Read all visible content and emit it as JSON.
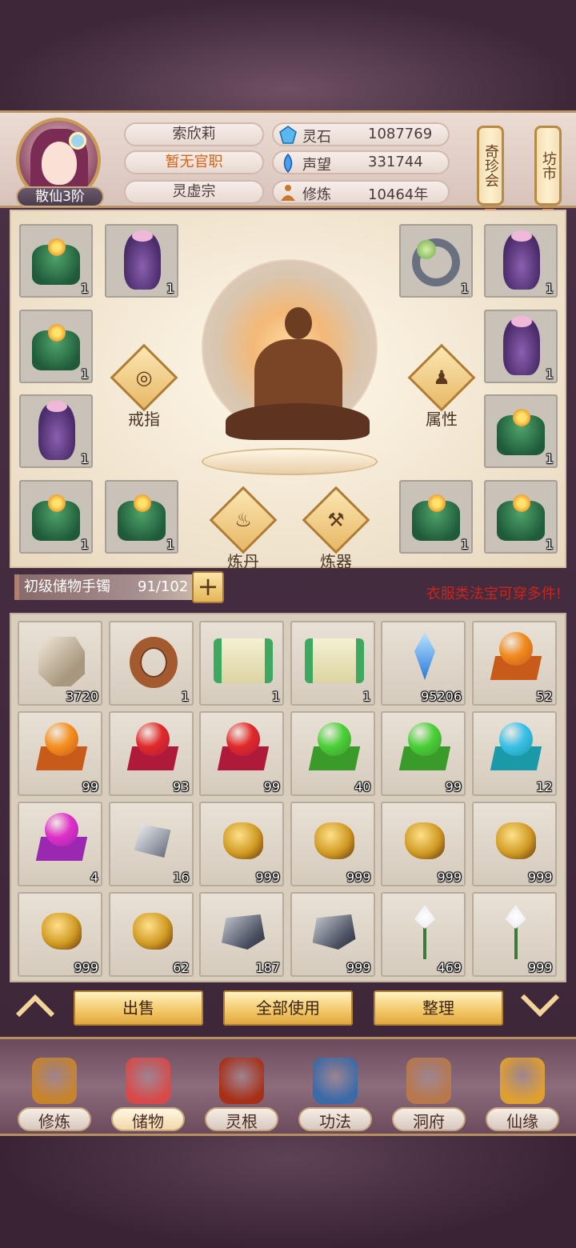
{
  "header": {
    "rank": "散仙3阶",
    "name": "索欣莉",
    "official": "暂无官职",
    "sect": "灵虚宗",
    "resources": [
      {
        "icon": "spirit-stone-icon",
        "label": "灵石",
        "value": "1087769"
      },
      {
        "icon": "reputation-icon",
        "label": "声望",
        "value": "331744"
      },
      {
        "icon": "cultivation-icon",
        "label": "修炼",
        "value": "10464年"
      }
    ],
    "treasure_hall": "奇珍会",
    "market": "坊市"
  },
  "equipment": {
    "slots": [
      {
        "icon": "green-robe-icon",
        "qty": "1"
      },
      {
        "icon": "purple-robe-icon",
        "qty": "1"
      },
      {
        "icon": "jade-ring-icon",
        "qty": "1"
      },
      {
        "icon": "purple-robe-icon",
        "qty": "1"
      },
      {
        "icon": "green-robe-icon",
        "qty": "1"
      },
      {
        "icon": "purple-robe-icon",
        "qty": "1"
      },
      {
        "icon": "purple-robe-icon",
        "qty": "1"
      },
      {
        "icon": "green-robe-icon",
        "qty": "1"
      },
      {
        "icon": "green-robe-icon",
        "qty": "1"
      },
      {
        "icon": "green-robe-icon",
        "qty": "1"
      },
      {
        "icon": "green-robe-icon",
        "qty": "1"
      },
      {
        "icon": "green-robe-icon",
        "qty": "1"
      }
    ],
    "ring_label": "戒指",
    "attr_label": "属性",
    "alchemy_label": "炼丹",
    "forge_label": "炼器"
  },
  "storage": {
    "name": "初级储物手镯",
    "capacity": "91/102",
    "plus": "+",
    "hint": "衣服类法宝可穿多件!"
  },
  "bag": [
    {
      "icon": "rune-stone-icon",
      "qty": "3720"
    },
    {
      "icon": "wooden-ring-icon",
      "qty": "1"
    },
    {
      "icon": "green-scroll-icon",
      "qty": "1"
    },
    {
      "icon": "green-scroll-icon",
      "qty": "1"
    },
    {
      "icon": "blue-crystal-icon",
      "qty": "95206"
    },
    {
      "icon": "orange-orb-icon",
      "qty": "52",
      "ball": "#f08a1c",
      "stand": "#c85a1a"
    },
    {
      "icon": "orange-orb-icon",
      "qty": "99",
      "ball": "#f4901e",
      "stand": "#c85a1a"
    },
    {
      "icon": "red-orb-icon",
      "qty": "93",
      "ball": "#e02a2a",
      "stand": "#b01a3a"
    },
    {
      "icon": "red-orb-icon",
      "qty": "99",
      "ball": "#e02a2a",
      "stand": "#b01a3a"
    },
    {
      "icon": "green-orb-icon",
      "qty": "40",
      "ball": "#4ad038",
      "stand": "#3a9a2a"
    },
    {
      "icon": "green-orb-icon",
      "qty": "99",
      "ball": "#4ad038",
      "stand": "#3a9a2a"
    },
    {
      "icon": "cyan-orb-icon",
      "qty": "12",
      "ball": "#3ac0e8",
      "stand": "#1a9aa8"
    },
    {
      "icon": "magenta-orb-icon",
      "qty": "4",
      "ball": "#e030c8",
      "stand": "#9a28b0"
    },
    {
      "icon": "silver-ore-icon",
      "qty": "16"
    },
    {
      "icon": "gold-ore-icon",
      "qty": "999"
    },
    {
      "icon": "gold-ore-icon",
      "qty": "999"
    },
    {
      "icon": "gold-ore-icon",
      "qty": "999"
    },
    {
      "icon": "gold-ore-icon",
      "qty": "999"
    },
    {
      "icon": "gold-ore-icon",
      "qty": "999"
    },
    {
      "icon": "gold-ore-icon",
      "qty": "62"
    },
    {
      "icon": "dark-ore-icon",
      "qty": "187"
    },
    {
      "icon": "dark-ore-icon",
      "qty": "999"
    },
    {
      "icon": "white-lily-icon",
      "qty": "469"
    },
    {
      "icon": "white-lily-icon",
      "qty": "999"
    }
  ],
  "actions": {
    "sell": "出售",
    "use_all": "全部使用",
    "sort": "整理"
  },
  "nav": [
    {
      "icon": "cultivate-icon",
      "label": "修炼",
      "color": "#c8842a"
    },
    {
      "icon": "storage-bag-icon",
      "label": "储物",
      "color": "#d84a4a",
      "active": true
    },
    {
      "icon": "spirit-root-icon",
      "label": "灵根",
      "color": "#a83018"
    },
    {
      "icon": "technique-book-icon",
      "label": "功法",
      "color": "#3a6aa8"
    },
    {
      "icon": "cave-mansion-icon",
      "label": "洞府",
      "color": "#b8784a"
    },
    {
      "icon": "fate-gourd-icon",
      "label": "仙缘",
      "color": "#e0a030"
    }
  ]
}
